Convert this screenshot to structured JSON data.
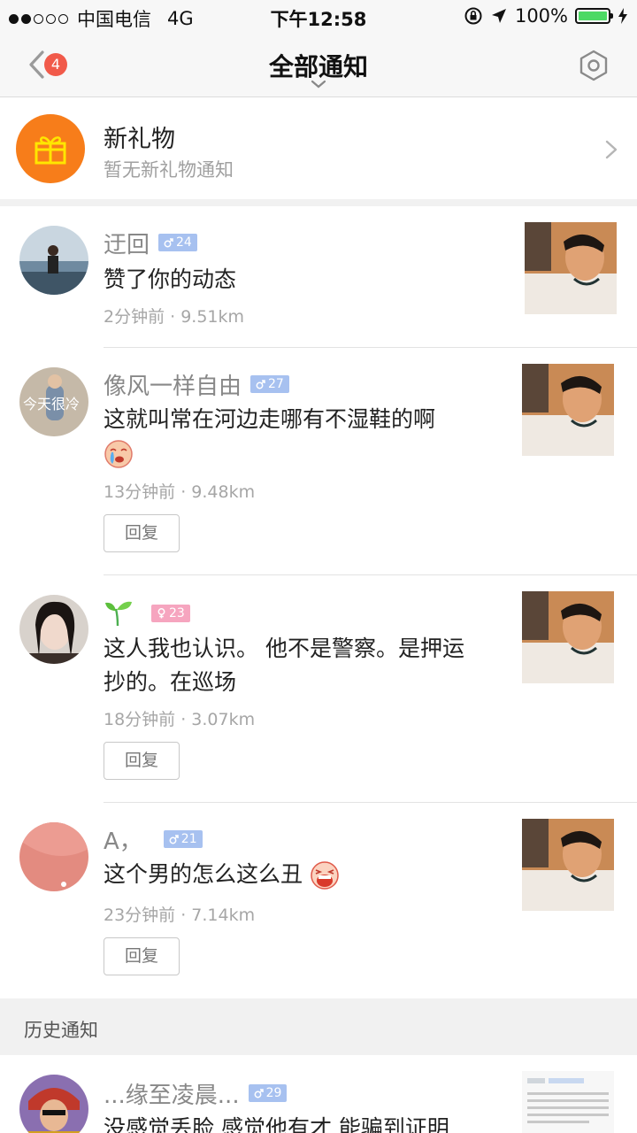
{
  "status_bar": {
    "carrier": "中国电信",
    "network": "4G",
    "time": "下午12:58",
    "battery": "100%",
    "battery_level": 1.0
  },
  "nav": {
    "badge_count": "4",
    "title": "全部通知"
  },
  "gift": {
    "title": "新礼物",
    "subtitle": "暂无新礼物通知"
  },
  "notifications": [
    {
      "name": "迂回",
      "gender": "male",
      "age": "24",
      "message": "赞了你的动态",
      "meta": "2分钟前 · 9.51km"
    },
    {
      "name": "像风一样自由",
      "gender": "male",
      "age": "27",
      "message": "这就叫常在河边走哪有不湿鞋的啊",
      "meta": "13分钟前 · 9.48km",
      "reply": "回复",
      "avatar_text": "今天很冷"
    },
    {
      "name": "",
      "gender": "female",
      "age": "23",
      "message": "这人我也认识。 他不是警察。是押运抄的。在巡场",
      "meta": "18分钟前 · 3.07km",
      "reply": "回复"
    },
    {
      "name": "A，",
      "gender": "male",
      "age": "21",
      "message": "这个男的怎么这么丑",
      "meta": "23分钟前 · 7.14km",
      "reply": "回复"
    }
  ],
  "history": {
    "label": "历史通知",
    "item": {
      "name": "...缘至凌晨...",
      "gender": "male",
      "age": "29",
      "message": "没感觉丢脸 感觉他有才 能骗到证明"
    }
  },
  "colors": {
    "accent_orange": "#f77d1a",
    "badge_red": "#f15a4a",
    "male_tag": "#a7c1f0",
    "female_tag": "#f6a5bf",
    "battery_green": "#4cd964"
  }
}
